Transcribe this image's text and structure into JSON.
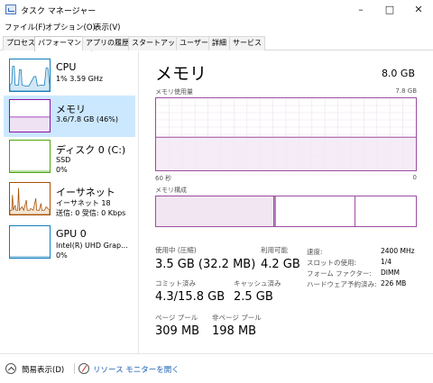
{
  "window": {
    "title": "タスク マネージャー",
    "minimize": "–",
    "maximize": "□",
    "close": "✕"
  },
  "menu": [
    "ファイル(F)",
    "オプション(O)",
    "表示(V)"
  ],
  "tabs": [
    "プロセス",
    "パフォーマンス",
    "アプリの履歴",
    "スタートアップ",
    "ユーザー",
    "詳細",
    "サービス"
  ],
  "active_tab_index": 1,
  "sidebar": [
    {
      "name": "CPU",
      "line2": "1%  3.59 GHz",
      "line3": "",
      "color": "#117dbb"
    },
    {
      "name": "メモリ",
      "line2": "3.6/7.8 GB (46%)",
      "line3": "",
      "color": "#8b12ae"
    },
    {
      "name": "ディスク 0 (C:)",
      "line2": "SSD",
      "line3": "0%",
      "color": "#4da60c"
    },
    {
      "name": "イーサネット",
      "line2": "イーサネット 18",
      "line3": "送信: 0 受信: 0 Kbps",
      "color": "#a74f01"
    },
    {
      "name": "GPU 0",
      "line2": "Intel(R) UHD Grap...",
      "line3": "0%",
      "color": "#117dbb"
    }
  ],
  "selected_sidebar_index": 1,
  "main": {
    "title": "メモリ",
    "total": "8.0 GB",
    "usage_caption": "メモリ使用量",
    "usage_max": "7.8 GB",
    "time_left": "60 秒",
    "time_right": "0",
    "composition_caption": "メモリ構成",
    "usage_fraction": 0.46,
    "accent": "#9b4da0"
  },
  "stats": {
    "in_use_label": "使用中 (圧縮)",
    "in_use_value": "3.5 GB (32.2 MB)",
    "available_label": "利用可能",
    "available_value": "4.2 GB",
    "committed_label": "コミット済み",
    "committed_value": "4.3/15.8 GB",
    "cached_label": "キャッシュ済み",
    "cached_value": "2.5 GB",
    "paged_label": "ページ プール",
    "paged_value": "309 MB",
    "nonpaged_label": "非ページ プール",
    "nonpaged_value": "198 MB"
  },
  "props": [
    {
      "label": "速度:",
      "value": "2400 MHz"
    },
    {
      "label": "スロットの使用:",
      "value": "1/4"
    },
    {
      "label": "フォーム ファクター:",
      "value": "DIMM"
    },
    {
      "label": "ハードウェア予約済み:",
      "value": "226 MB"
    }
  ],
  "footer": {
    "fewer_details": "簡易表示(D)",
    "resource_monitor": "リソース モニターを開く"
  }
}
